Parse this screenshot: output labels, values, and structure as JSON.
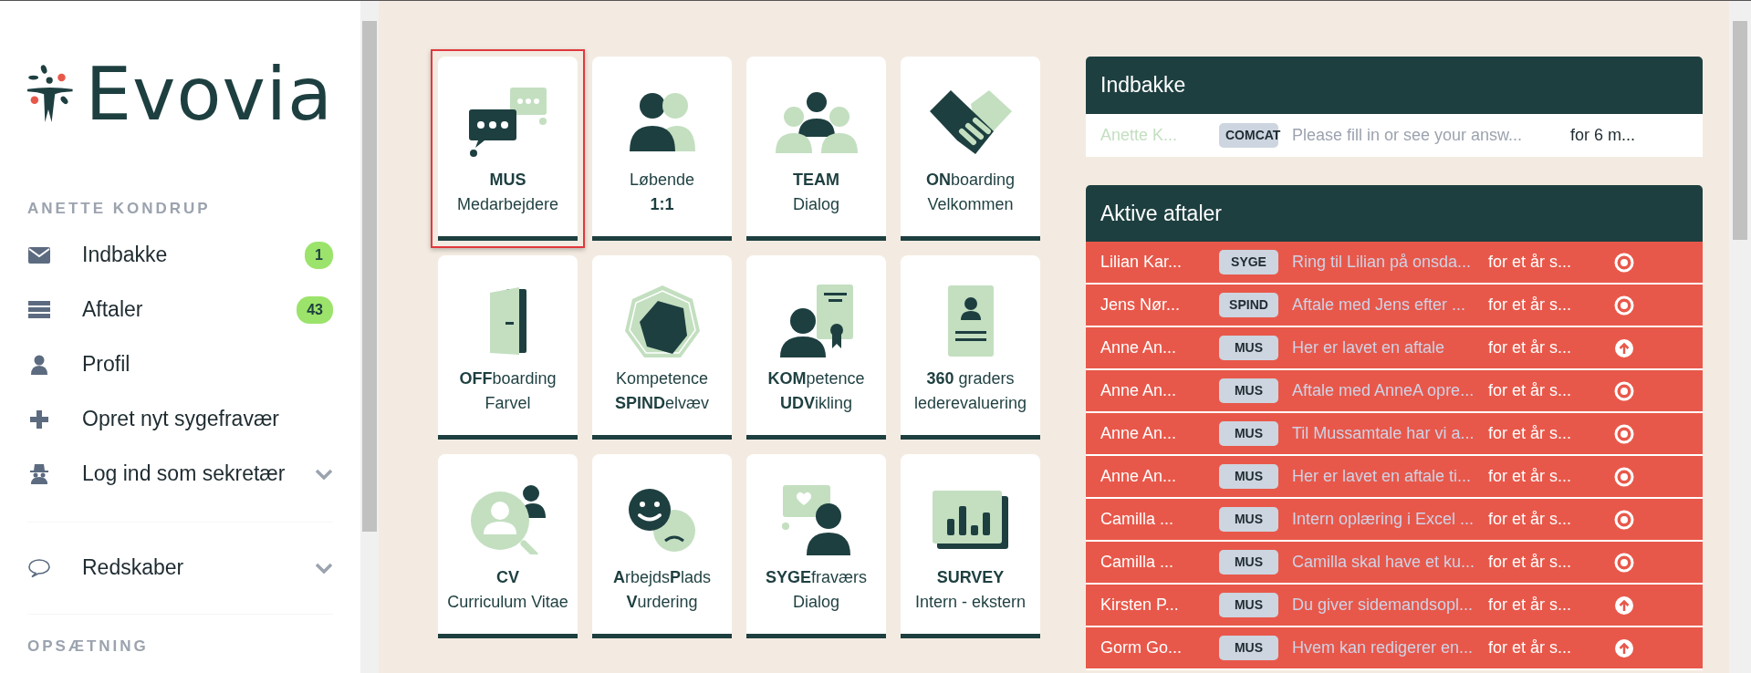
{
  "sidebar": {
    "logo_text": "Evovia",
    "user_heading": "ANETTE KONDRUP",
    "items": [
      {
        "label": "Indbakke",
        "badge": "1",
        "expandable": false
      },
      {
        "label": "Aftaler",
        "badge": "43",
        "expandable": false
      },
      {
        "label": "Profil",
        "expandable": false
      },
      {
        "label": "Opret nyt sygefravær",
        "expandable": false
      },
      {
        "label": "Log ind som sekretær",
        "expandable": true
      }
    ],
    "tools": {
      "label": "Redskaber",
      "expandable": true
    },
    "settings_heading": "OPSÆTNING"
  },
  "tiles": [
    {
      "line_1": "**MUS**",
      "line_2": "Medarbejdere",
      "selected": true
    },
    {
      "line_1": "Løbende",
      "line_2": "**1:1**",
      "selected": false
    },
    {
      "line_1": "**TEAM**",
      "line_2": "Dialog",
      "selected": false
    },
    {
      "line_1": "**ON**boarding",
      "line_2": "Velkommen",
      "selected": false
    },
    {
      "line_1": "**OFF**boarding",
      "line_2": "Farvel",
      "selected": false
    },
    {
      "line_1": "Kompetence",
      "line_2": "**SPIND**elvæv",
      "selected": false
    },
    {
      "line_1": "**KOM**petence",
      "line_2": "**UDV**ikling",
      "selected": false
    },
    {
      "line_1": "**360** graders",
      "line_2": "lederevaluering",
      "selected": false
    },
    {
      "line_1": "**CV**",
      "line_2": "Curriculum Vitae",
      "selected": false
    },
    {
      "line_1": "**A**rbejds**P**lads",
      "line_2": "**V**urdering",
      "selected": false
    },
    {
      "line_1": "**SYGE**fraværs",
      "line_2": "Dialog",
      "selected": false
    },
    {
      "line_1": "**SURVEY**",
      "line_2": "Intern - ekstern",
      "selected": false
    }
  ],
  "inbox": {
    "title": "Indbakke",
    "rows": [
      {
        "sender": "Anette K...",
        "tag": "COMCAT",
        "message": "Please fill in or see your answ...",
        "time": "for 6 m..."
      }
    ]
  },
  "appointments": {
    "title": "Aktive aftaler",
    "rows": [
      {
        "name": "Lilian Kar...",
        "tag": "SYGE",
        "text": "Ring til Lilian på onsda...",
        "time": "for et år s...",
        "kind": "target"
      },
      {
        "name": "Jens Nør...",
        "tag": "SPIND",
        "text": "Aftale med Jens efter ...",
        "time": "for et år s...",
        "kind": "target"
      },
      {
        "name": "Anne An...",
        "tag": "MUS",
        "text": "Her er lavet en aftale",
        "time": "for et år s...",
        "kind": "upload"
      },
      {
        "name": "Anne An...",
        "tag": "MUS",
        "text": "Aftale med AnneA opre...",
        "time": "for et år s...",
        "kind": "target"
      },
      {
        "name": "Anne An...",
        "tag": "MUS",
        "text": "Til Mussamtale har vi a...",
        "time": "for et år s...",
        "kind": "target"
      },
      {
        "name": "Anne An...",
        "tag": "MUS",
        "text": "Her er lavet en aftale ti...",
        "time": "for et år s...",
        "kind": "target"
      },
      {
        "name": "Camilla ...",
        "tag": "MUS",
        "text": "Intern oplæring i Excel ...",
        "time": "for et år s...",
        "kind": "target"
      },
      {
        "name": "Camilla ...",
        "tag": "MUS",
        "text": "Camilla skal have et ku...",
        "time": "for et år s...",
        "kind": "target"
      },
      {
        "name": "Kirsten P...",
        "tag": "MUS",
        "text": "Du giver sidemandsopl...",
        "time": "for et år s...",
        "kind": "upload"
      },
      {
        "name": "Gorm Go...",
        "tag": "MUS",
        "text": "Hvem kan redigerer en...",
        "time": "for et år s...",
        "kind": "upload"
      }
    ]
  }
}
